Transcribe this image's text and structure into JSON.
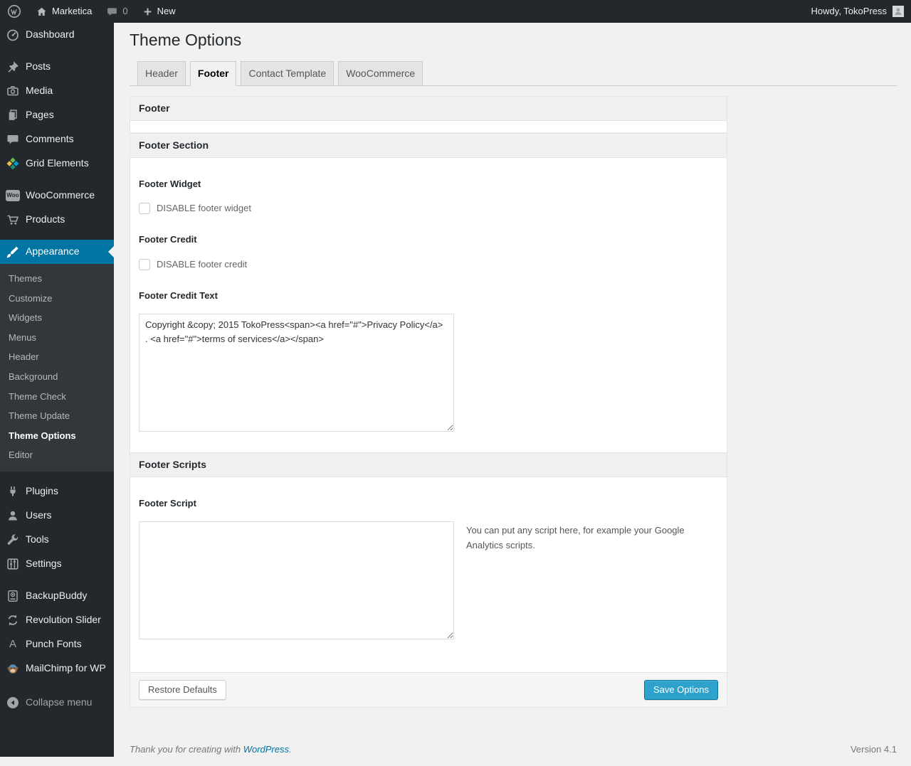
{
  "colors": {
    "accent_blue": "#0074a2",
    "primary_button": "#2ea2cc",
    "sidebar_bg": "#23282d",
    "submenu_bg": "#32373c",
    "page_bg": "#f1f1f1"
  },
  "admin_bar": {
    "site_name": "Marketica",
    "comments_count": "0",
    "new_label": "New",
    "howdy": "Howdy, TokoPress"
  },
  "sidebar": {
    "items": [
      {
        "label": "Dashboard",
        "icon": "dashboard-icon"
      },
      {
        "label": "Posts",
        "icon": "pushpin-icon"
      },
      {
        "label": "Media",
        "icon": "camera-icon"
      },
      {
        "label": "Pages",
        "icon": "pages-icon"
      },
      {
        "label": "Comments",
        "icon": "comment-icon"
      },
      {
        "label": "Grid Elements",
        "icon": "grid-icon"
      },
      {
        "label": "WooCommerce",
        "icon": "woo-badge-icon",
        "badge_text": "Woo"
      },
      {
        "label": "Products",
        "icon": "cart-icon"
      },
      {
        "label": "Appearance",
        "icon": "brush-icon",
        "active": true
      },
      {
        "label": "Plugins",
        "icon": "plug-icon"
      },
      {
        "label": "Users",
        "icon": "user-icon"
      },
      {
        "label": "Tools",
        "icon": "wrench-icon"
      },
      {
        "label": "Settings",
        "icon": "settings-icon"
      },
      {
        "label": "BackupBuddy",
        "icon": "backup-drive-icon"
      },
      {
        "label": "Revolution Slider",
        "icon": "rotate-arrows-icon"
      },
      {
        "label": "Punch Fonts",
        "icon": "letter-a-icon",
        "icon_text": "A"
      },
      {
        "label": "MailChimp for WP",
        "icon": "monkey-icon"
      },
      {
        "label": "Collapse menu",
        "icon": "collapse-arrow-icon"
      }
    ],
    "appearance_submenu": {
      "items": [
        {
          "label": "Themes"
        },
        {
          "label": "Customize"
        },
        {
          "label": "Widgets"
        },
        {
          "label": "Menus"
        },
        {
          "label": "Header"
        },
        {
          "label": "Background"
        },
        {
          "label": "Theme Check"
        },
        {
          "label": "Theme Update"
        },
        {
          "label": "Theme Options",
          "current": true
        },
        {
          "label": "Editor"
        }
      ]
    }
  },
  "page": {
    "title": "Theme Options",
    "tabs": [
      {
        "label": "Header",
        "active": false
      },
      {
        "label": "Footer",
        "active": true
      },
      {
        "label": "Contact Template",
        "active": false
      },
      {
        "label": "WooCommerce",
        "active": false
      }
    ]
  },
  "panel": {
    "box_title": "Footer",
    "section_title": "Footer Section",
    "footer_widget": {
      "label": "Footer Widget",
      "checkbox_label": "DISABLE footer widget",
      "checked": false
    },
    "footer_credit": {
      "label": "Footer Credit",
      "checkbox_label": "DISABLE footer credit",
      "checked": false
    },
    "footer_credit_text": {
      "label": "Footer Credit Text",
      "value": "Copyright &copy; 2015 TokoPress<span><a href=\"#\">Privacy Policy</a> . <a href=\"#\">terms of services</a></span>"
    },
    "scripts_title": "Footer Scripts",
    "footer_script": {
      "label": "Footer Script",
      "value": "",
      "help": "You can put any script here, for example your Google Analytics scripts."
    },
    "buttons": {
      "restore": "Restore Defaults",
      "save": "Save Options"
    }
  },
  "page_footer": {
    "thanks_prefix": "Thank you for creating with ",
    "wordpress_link": "WordPress",
    "thanks_suffix": ".",
    "version": "Version 4.1"
  }
}
